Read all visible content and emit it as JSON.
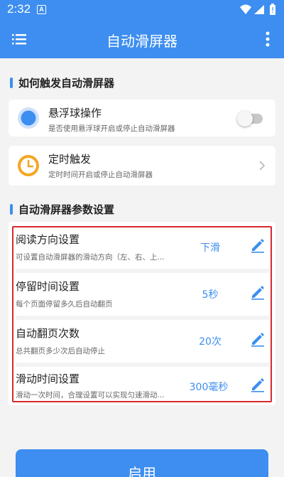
{
  "status_bar": {
    "time": "2:32",
    "notification_icon": "A",
    "icons": [
      "wifi-icon",
      "signal-icon",
      "battery-icon"
    ]
  },
  "app_bar": {
    "title": "自动滑屏器"
  },
  "trigger_section": {
    "heading": "如何触发自动滑屏器",
    "items": [
      {
        "title": "悬浮球操作",
        "subtitle": "是否使用悬浮球开启或停止自动滑屏器",
        "toggle_on": false
      },
      {
        "title": "定时触发",
        "subtitle": "定时时间开启或停止自动滑屏器"
      }
    ]
  },
  "params_section": {
    "heading": "自动滑屏器参数设置",
    "items": [
      {
        "title": "阅读方向设置",
        "subtitle": "可设置自动滑屏器的滑动方向（左、右、上...",
        "value": "下滑"
      },
      {
        "title": "停留时间设置",
        "subtitle": "每个页面停留多久后自动翻页",
        "value": "5秒"
      },
      {
        "title": "自动翻页次数",
        "subtitle": "总共翻页多少次后自动停止",
        "value": "20次"
      },
      {
        "title": "滑动时间设置",
        "subtitle": "滑动一次时间，合理设置可以实现匀速滑动...",
        "value": "300毫秒"
      }
    ]
  },
  "primary_button": {
    "label": "启用"
  },
  "colors": {
    "accent": "#3d8ef0",
    "highlight_border": "#d8292f",
    "timer_icon": "#f5a623"
  }
}
